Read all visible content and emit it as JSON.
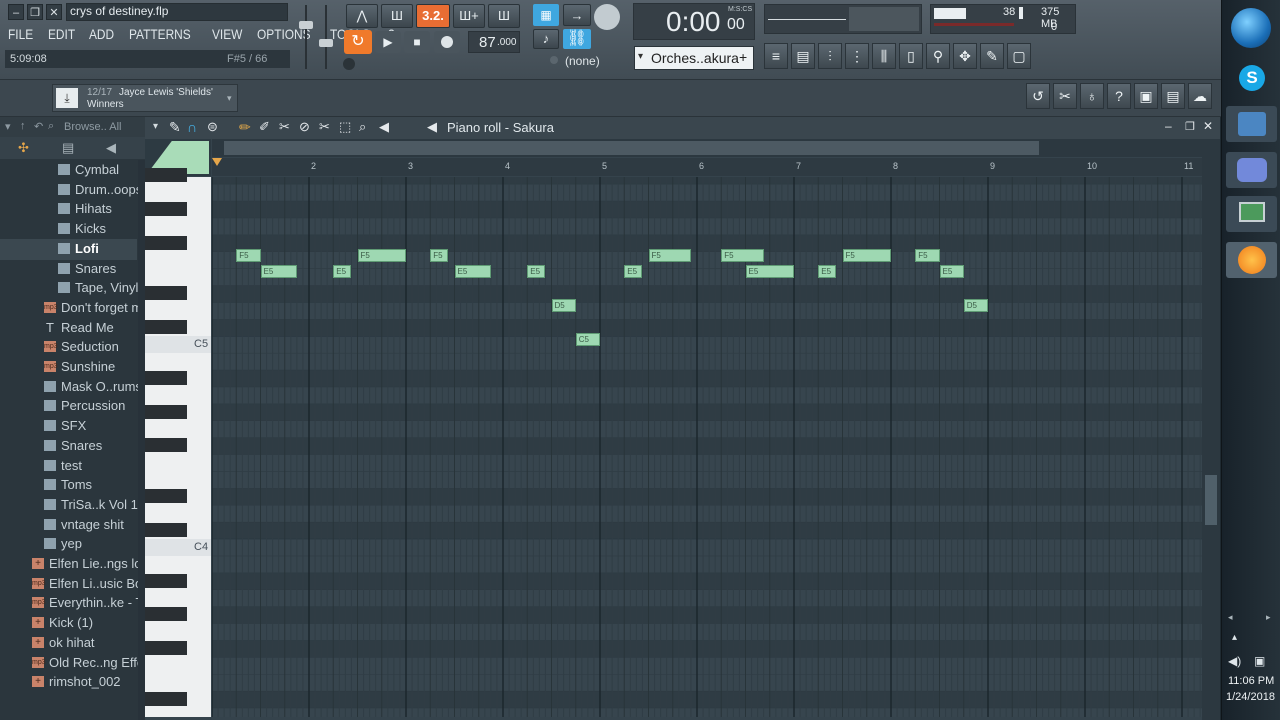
{
  "window": {
    "title": "crys of destiney.flp",
    "menu": [
      "FILE",
      "EDIT",
      "ADD",
      "PATTERNS",
      "VIEW",
      "OPTIONS",
      "TOOLS",
      "?"
    ],
    "hint_time": "5:09:08",
    "hint_pos": "F#5 / 66"
  },
  "transport": {
    "tempo": "87",
    "tempo_frac": ".000",
    "time_main": "0:00",
    "time_sub": "00",
    "time_mode": "M:S:CS",
    "pattern_value": "3.2.",
    "none_select": "(none)",
    "channel": "Orches..akura",
    "cpu": "38",
    "ram": "375 MB",
    "poly": "0"
  },
  "news": {
    "counter": "12/17",
    "artist": "Jayce Lewis 'Shields'",
    "headline": "Winners"
  },
  "browser": {
    "header": "Browse.. All",
    "items": [
      {
        "label": "Cymbal",
        "type": "folder",
        "indent": 2
      },
      {
        "label": "Drum..oops",
        "type": "folder",
        "indent": 2
      },
      {
        "label": "Hihats",
        "type": "folder",
        "indent": 2
      },
      {
        "label": "Kicks",
        "type": "folder",
        "indent": 2
      },
      {
        "label": "Lofi",
        "type": "folder",
        "indent": 2,
        "selected": true
      },
      {
        "label": "Snares",
        "type": "folder",
        "indent": 2
      },
      {
        "label": "Tape, Vinyl",
        "type": "folder",
        "indent": 2
      },
      {
        "label": "Don't forget me",
        "type": "mp3",
        "indent": 1
      },
      {
        "label": "Read Me",
        "type": "text",
        "indent": 1
      },
      {
        "label": "Seduction",
        "type": "mp3",
        "indent": 1
      },
      {
        "label": "Sunshine",
        "type": "mp3",
        "indent": 1
      },
      {
        "label": "Mask O..rums",
        "type": "folder",
        "indent": 1
      },
      {
        "label": "Percussion",
        "type": "folder",
        "indent": 1
      },
      {
        "label": "SFX",
        "type": "folder",
        "indent": 1
      },
      {
        "label": "Snares",
        "type": "folder",
        "indent": 1
      },
      {
        "label": "test",
        "type": "folder",
        "indent": 1
      },
      {
        "label": "Toms",
        "type": "folder",
        "indent": 1
      },
      {
        "label": "TriSa..k Vol 1",
        "type": "folder",
        "indent": 1
      },
      {
        "label": "vntage shit",
        "type": "folder",
        "indent": 1
      },
      {
        "label": "yep",
        "type": "folder",
        "indent": 1
      },
      {
        "label": "Elfen Lie..ngs loop",
        "type": "audio",
        "indent": 0
      },
      {
        "label": "Elfen Li..usic Box)",
        "type": "mp3",
        "indent": 0
      },
      {
        "label": "Everythin..ke - TAG",
        "type": "mp3",
        "indent": 0
      },
      {
        "label": "Kick (1)",
        "type": "audio",
        "indent": 0
      },
      {
        "label": "ok hihat",
        "type": "audio",
        "indent": 0
      },
      {
        "label": "Old Rec..ng Effect",
        "type": "mp3",
        "indent": 0
      },
      {
        "label": "rimshot_002",
        "type": "audio",
        "indent": 0
      }
    ]
  },
  "pianoroll": {
    "title": "Piano roll - Sakura",
    "bars": [
      "2",
      "3",
      "4",
      "5",
      "6",
      "7",
      "8",
      "9",
      "10",
      "11"
    ],
    "octave_labels": [
      "C5",
      "C4"
    ],
    "notes": [
      {
        "label": "F5",
        "bar": 1.25,
        "len": 0.25,
        "pitch": "F5"
      },
      {
        "label": "E5",
        "bar": 1.5,
        "len": 0.375,
        "pitch": "E5"
      },
      {
        "label": "E5",
        "bar": 2.25,
        "len": 0.1875,
        "pitch": "E5"
      },
      {
        "label": "F5",
        "bar": 2.5,
        "len": 0.5,
        "pitch": "F5"
      },
      {
        "label": "F5",
        "bar": 3.25,
        "len": 0.1875,
        "pitch": "F5"
      },
      {
        "label": "E5",
        "bar": 3.5,
        "len": 0.375,
        "pitch": "E5"
      },
      {
        "label": "E5",
        "bar": 4.25,
        "len": 0.1875,
        "pitch": "E5"
      },
      {
        "label": "D5",
        "bar": 4.5,
        "len": 0.25,
        "pitch": "D5"
      },
      {
        "label": "C5",
        "bar": 4.75,
        "len": 0.25,
        "pitch": "C5"
      },
      {
        "label": "E5",
        "bar": 5.25,
        "len": 0.1875,
        "pitch": "E5"
      },
      {
        "label": "F5",
        "bar": 5.5,
        "len": 0.4375,
        "pitch": "F5"
      },
      {
        "label": "F5",
        "bar": 6.25,
        "len": 0.4375,
        "pitch": "F5"
      },
      {
        "label": "E5",
        "bar": 6.5,
        "len": 0.5,
        "pitch": "E5"
      },
      {
        "label": "E5",
        "bar": 7.25,
        "len": 0.1875,
        "pitch": "E5"
      },
      {
        "label": "F5",
        "bar": 7.5,
        "len": 0.5,
        "pitch": "F5"
      },
      {
        "label": "F5",
        "bar": 8.25,
        "len": 0.25,
        "pitch": "F5"
      },
      {
        "label": "E5",
        "bar": 8.5,
        "len": 0.25,
        "pitch": "E5"
      },
      {
        "label": "D5",
        "bar": 8.75,
        "len": 0.25,
        "pitch": "D5"
      }
    ]
  },
  "clock": {
    "time": "11:06 PM",
    "date": "1/24/2018"
  },
  "colors": {
    "note_fill": "#9ed8b2",
    "grid_bg": "#35434c",
    "accent_orange": "#f07a2b",
    "accent_blue": "#46b4ea"
  }
}
